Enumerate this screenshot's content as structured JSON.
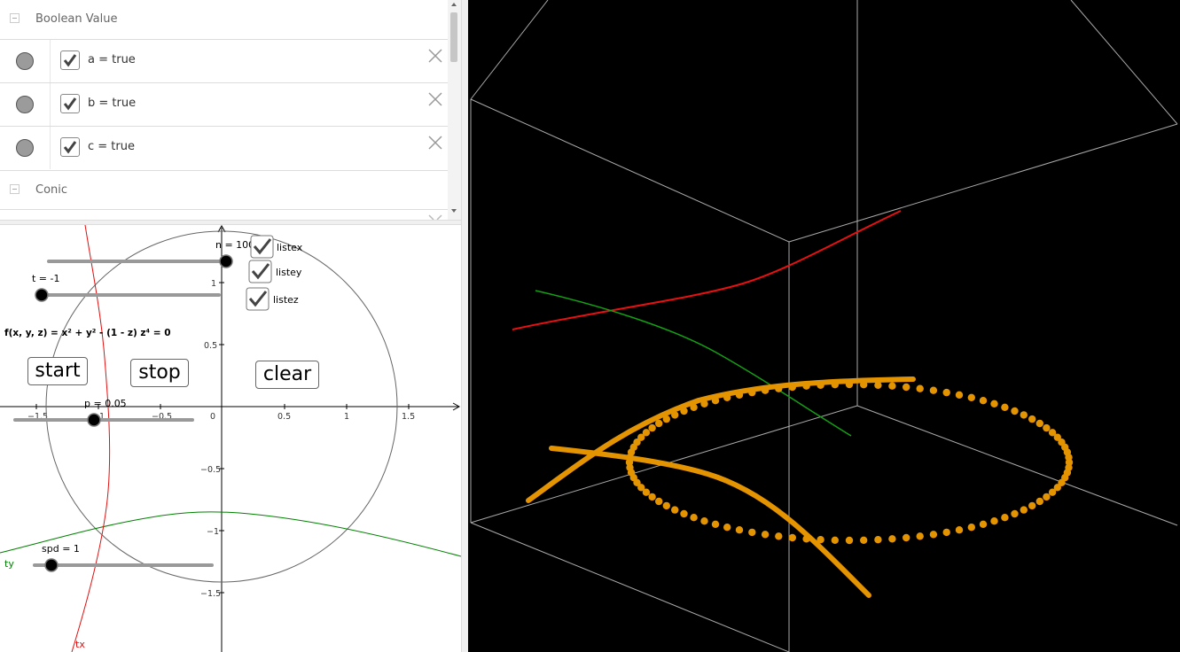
{
  "algebra": {
    "group_boolean": "Boolean Value",
    "rows": [
      {
        "expr": "a = true",
        "checked": true
      },
      {
        "expr": "b = true",
        "checked": true
      },
      {
        "expr": "c = true",
        "checked": true
      }
    ],
    "group_conic": "Conic"
  },
  "graphics2d": {
    "sliders": {
      "n": "n = 100",
      "t": "t = -1",
      "p": "p = 0.05",
      "spd": "spd = 1"
    },
    "checkboxes": {
      "listex": "listex",
      "listey": "listey",
      "listez": "listez"
    },
    "equation": "f(x, y, z) = x² + y² - (1 - z) z⁴ = 0",
    "buttons": {
      "start": "start",
      "stop": "stop",
      "clear": "clear"
    },
    "x_ticks": [
      "−1.5",
      "−1",
      "−0.5",
      "0",
      "0.5",
      "1",
      "1.5"
    ],
    "y_ticks": [
      "1",
      "0.5",
      "−0.5",
      "−1",
      "−1.5"
    ],
    "curve_labels": {
      "tx": "tx",
      "ty": "ty"
    },
    "colors": {
      "tx": "#e01010",
      "ty": "#008000",
      "circle": "#666666",
      "axis": "#000000"
    }
  },
  "graphics3d": {
    "background": "#000000",
    "colors": {
      "box": "#bbbbbb",
      "red_curve": "#e81010",
      "green_curve": "#14a014",
      "points": "#e49400"
    }
  }
}
